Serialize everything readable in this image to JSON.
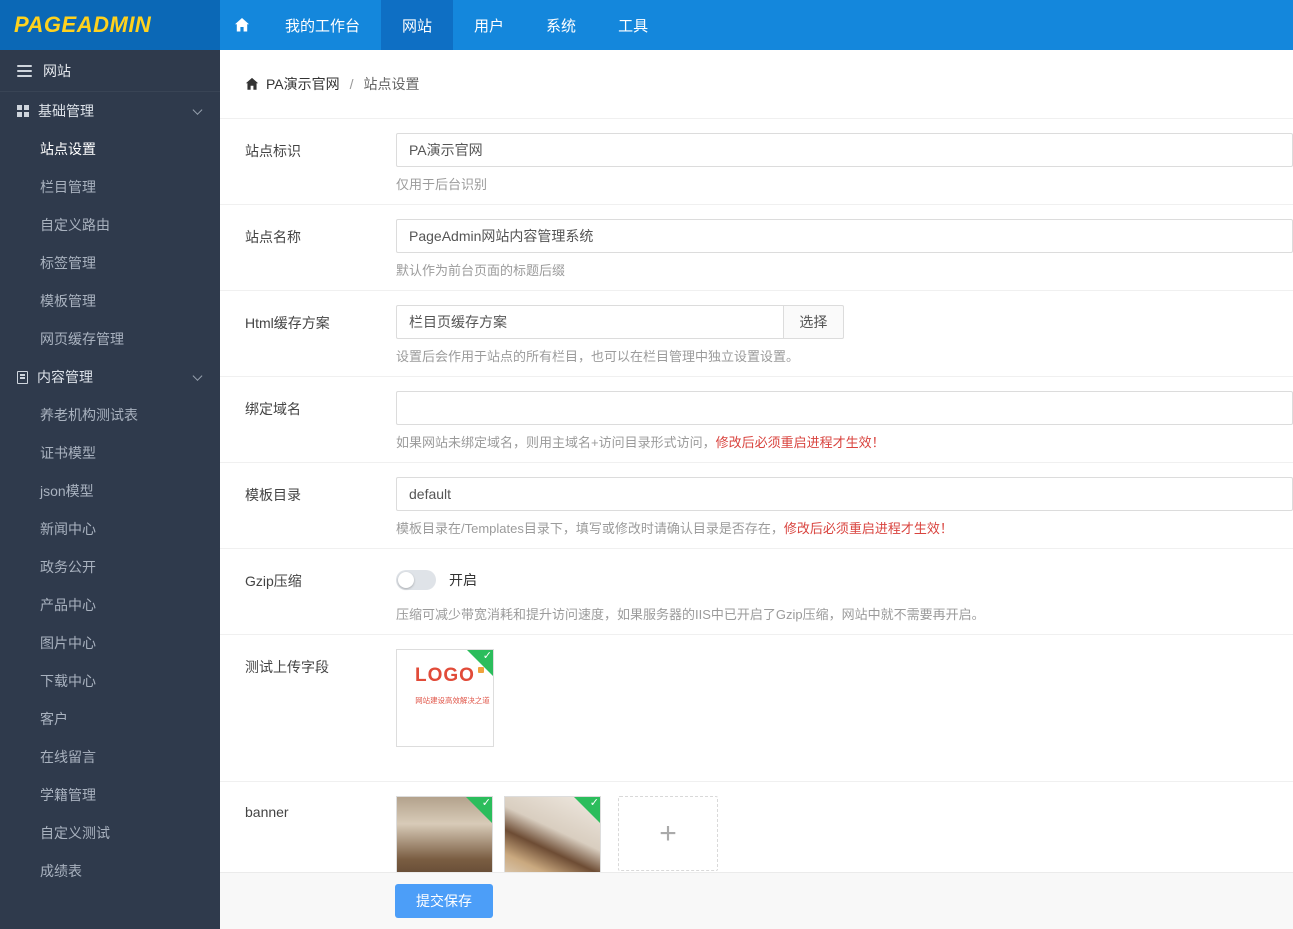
{
  "brand": {
    "name": "PAGEADMIN"
  },
  "topnav": {
    "items": [
      {
        "label": "我的工作台",
        "active": false
      },
      {
        "label": "网站",
        "active": true
      },
      {
        "label": "用户",
        "active": false
      },
      {
        "label": "系统",
        "active": false
      },
      {
        "label": "工具",
        "active": false
      }
    ]
  },
  "sidebar": {
    "title": "网站",
    "groups": [
      {
        "label": "基础管理",
        "items": [
          {
            "label": "站点设置",
            "active": true
          },
          {
            "label": "栏目管理",
            "active": false
          },
          {
            "label": "自定义路由",
            "active": false
          },
          {
            "label": "标签管理",
            "active": false
          },
          {
            "label": "模板管理",
            "active": false
          },
          {
            "label": "网页缓存管理",
            "active": false
          }
        ]
      },
      {
        "label": "内容管理",
        "items": [
          {
            "label": "养老机构测试表",
            "active": false
          },
          {
            "label": "证书模型",
            "active": false
          },
          {
            "label": "json模型",
            "active": false
          },
          {
            "label": "新闻中心",
            "active": false
          },
          {
            "label": "政务公开",
            "active": false
          },
          {
            "label": "产品中心",
            "active": false
          },
          {
            "label": "图片中心",
            "active": false
          },
          {
            "label": "下载中心",
            "active": false
          },
          {
            "label": "客户",
            "active": false
          },
          {
            "label": "在线留言",
            "active": false
          },
          {
            "label": "学籍管理",
            "active": false
          },
          {
            "label": "自定义测试",
            "active": false
          },
          {
            "label": "成绩表",
            "active": false
          }
        ]
      }
    ]
  },
  "breadcrumb": {
    "root": "PA演示官网",
    "separator": "/",
    "current": "站点设置"
  },
  "form": {
    "site_id": {
      "label": "站点标识",
      "value": "PA演示官网",
      "help": "仅用于后台识别"
    },
    "site_name": {
      "label": "站点名称",
      "value": "PageAdmin网站内容管理系统",
      "help": "默认作为前台页面的标题后缀"
    },
    "html_cache": {
      "label": "Html缓存方案",
      "value": "栏目页缓存方案",
      "button": "选择",
      "help": "设置后会作用于站点的所有栏目，也可以在栏目管理中独立设置设置。"
    },
    "domain": {
      "label": "绑定域名",
      "value": "",
      "help": "如果网站未绑定域名，则用主域名+访问目录形式访问，",
      "help_warning": "修改后必须重启进程才生效！"
    },
    "template_dir": {
      "label": "模板目录",
      "value": "default",
      "help": "模板目录在/Templates目录下，填写或修改时请确认目录是否存在，",
      "help_warning": "修改后必须重启进程才生效！"
    },
    "gzip": {
      "label": "Gzip压缩",
      "state": "off",
      "toggle_label": "开启",
      "help": "压缩可减少带宽消耗和提升访问速度，如果服务器的IIS中已开启了Gzip压缩，网站中就不需要再开启。"
    },
    "upload_test": {
      "label": "测试上传字段",
      "image_title": "LOGO",
      "image_subtitle": "网站建设高效解决之道"
    },
    "banner": {
      "label": "banner",
      "images_count": 2,
      "add_label": "+"
    }
  },
  "footer": {
    "submit": "提交保存"
  },
  "colors": {
    "topbar": "#1487dc",
    "topbar_dark": "#0b68b6",
    "topbar_active": "#0e6fc4",
    "logo_yellow": "#ffd21e",
    "sidebar_bg": "#2f3a4c",
    "accent_red": "#d9433e",
    "submit_blue": "#4c9ef8",
    "badge_green": "#2bbd5c"
  }
}
